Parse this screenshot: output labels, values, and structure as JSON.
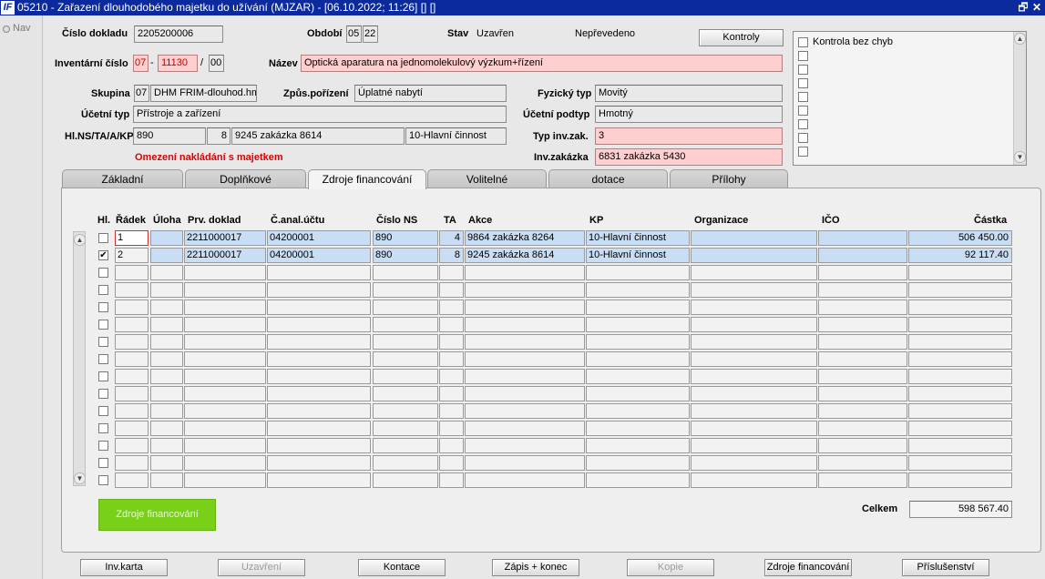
{
  "window": {
    "title": "05210 - Zařazení dlouhodobého majetku do užívání (MJZAR) - [06.10.2022; 11:26] [] []",
    "logo": "IF",
    "restore_glyph": "🗗",
    "close_glyph": "✕"
  },
  "nav": {
    "label": "Nav"
  },
  "header": {
    "cislo_dokladu_label": "Číslo dokladu",
    "cislo_dokladu": "2205200006",
    "obdobi_label": "Období",
    "obdobi_month": "05",
    "obdobi_year": "22",
    "stav_label": "Stav",
    "stav_value": "Uzavřen",
    "neprevedeno": "Nepřevedeno",
    "kontroly_button": "Kontroly",
    "inventarni_cislo_label": "Inventární číslo",
    "inv_a": "07",
    "inv_sep1": "-",
    "inv_b": "11130",
    "inv_sep2": "/",
    "inv_c": "00",
    "nazev_label": "Název",
    "nazev": "Optická aparatura na jednomolekulový výzkum+řízení",
    "skupina_label": "Skupina",
    "skupina_code": "07",
    "skupina_name": "DHM FRIM-dlouhod.hmo",
    "zpusob_label": "Způs.pořízení",
    "zpusob": "Úplatné nabytí",
    "fyzicky_typ_label": "Fyzický typ",
    "fyzicky_typ": "Movitý",
    "ucetni_typ_label": "Účetní typ",
    "ucetni_typ": "Přístroje a zařízení",
    "ucetni_podtyp_label": "Účetní podtyp",
    "ucetni_podtyp": "Hmotný",
    "hlns_label": "Hl.NS/TA/A/KP",
    "hlns_ns": "890",
    "hlns_ta": "8",
    "hlns_akce": "9245 zakázka 8614",
    "hlns_kp": "10-Hlavní činnost",
    "typ_inv_zak_label": "Typ inv.zak.",
    "typ_inv_zak": "3",
    "omezeni": "Omezení nakládání s majetkem",
    "inv_zakazka_label": "Inv.zakázka",
    "inv_zakazka": "6831 zakázka 5430"
  },
  "check_panel": {
    "first_label": "Kontrola bez chyb"
  },
  "tabs": [
    {
      "label": "Základní"
    },
    {
      "label": "Doplňkové"
    },
    {
      "label": "Zdroje financování"
    },
    {
      "label": "Volitelné"
    },
    {
      "label": "dotace"
    },
    {
      "label": "Přílohy"
    }
  ],
  "table": {
    "columns": {
      "hl": "Hl.",
      "radek": "Řádek",
      "uloha": "Úloha",
      "prv_doklad": "Prv. doklad",
      "c_anal_uctu": "Č.anal.účtu",
      "cislo_ns": "Číslo NS",
      "ta": "TA",
      "akce": "Akce",
      "kp": "KP",
      "organizace": "Organizace",
      "ico": "IČO",
      "castka": "Částka"
    },
    "rows": [
      {
        "hl": "",
        "radek": "1",
        "uloha": "",
        "prv_doklad": "2211000017",
        "c_anal_uctu": "04200001",
        "cislo_ns": "890",
        "ta": "4",
        "akce": "9864 zakázka 8264",
        "kp": "10-Hlavní činnost",
        "organizace": "",
        "ico": "",
        "castka": "506 450.00"
      },
      {
        "hl": "✔",
        "radek": "2",
        "uloha": "",
        "prv_doklad": "2211000017",
        "c_anal_uctu": "04200001",
        "cislo_ns": "890",
        "ta": "8",
        "akce": "9245 zakázka 8614",
        "kp": "10-Hlavní činnost",
        "organizace": "",
        "ico": "",
        "castka": "92 117.40"
      }
    ],
    "empty_rows": 13
  },
  "footer": {
    "green_button": "Zdroje financování",
    "celkem_label": "Celkem",
    "celkem_value": "598 567.40"
  },
  "bottom_buttons": [
    {
      "label": "Inv.karta",
      "enabled": true
    },
    {
      "label": "Uzavření",
      "enabled": false
    },
    {
      "label": "Kontace",
      "enabled": true
    },
    {
      "label": "Zápis + konec",
      "enabled": true
    },
    {
      "label": "Kopie",
      "enabled": false
    },
    {
      "label": "Zdroje financování",
      "enabled": true
    },
    {
      "label": "Příslušenství",
      "enabled": true
    }
  ],
  "colors": {
    "title_bar": "#0a2a9e",
    "highlight_pink": "#ffcfcf",
    "warning_red": "#e00000",
    "selected_row": "#c9def5",
    "green_button": "#78d018"
  }
}
